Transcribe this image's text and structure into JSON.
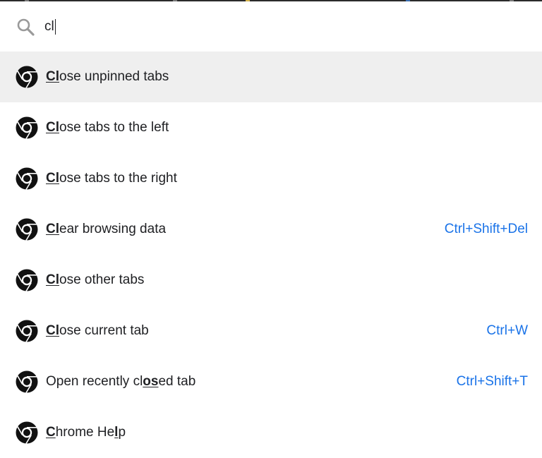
{
  "search": {
    "value": "cl",
    "icon": "search-icon"
  },
  "colors": {
    "accent": "#1a73e8",
    "selected_bg": "#efefef",
    "text": "#202124"
  },
  "results": [
    {
      "icon": "chrome-icon",
      "label": "Close unpinned tabs",
      "match_spans": [
        [
          0,
          2
        ]
      ],
      "shortcut": "",
      "selected": true
    },
    {
      "icon": "chrome-icon",
      "label": "Close tabs to the left",
      "match_spans": [
        [
          0,
          2
        ]
      ],
      "shortcut": "",
      "selected": false
    },
    {
      "icon": "chrome-icon",
      "label": "Close tabs to the right",
      "match_spans": [
        [
          0,
          2
        ]
      ],
      "shortcut": "",
      "selected": false
    },
    {
      "icon": "chrome-icon",
      "label": "Clear browsing data",
      "match_spans": [
        [
          0,
          2
        ]
      ],
      "shortcut": "Ctrl+Shift+Del",
      "selected": false
    },
    {
      "icon": "chrome-icon",
      "label": "Close other tabs",
      "match_spans": [
        [
          0,
          2
        ]
      ],
      "shortcut": "",
      "selected": false
    },
    {
      "icon": "chrome-icon",
      "label": "Close current tab",
      "match_spans": [
        [
          0,
          2
        ]
      ],
      "shortcut": "Ctrl+W",
      "selected": false
    },
    {
      "icon": "chrome-icon",
      "label": "Open recently closed tab",
      "match_spans": [
        [
          16,
          18
        ]
      ],
      "shortcut": "Ctrl+Shift+T",
      "selected": false
    },
    {
      "icon": "chrome-icon",
      "label": "Chrome Help",
      "match_spans": [
        [
          0,
          1
        ],
        [
          9,
          10
        ]
      ],
      "shortcut": "",
      "selected": false
    }
  ]
}
